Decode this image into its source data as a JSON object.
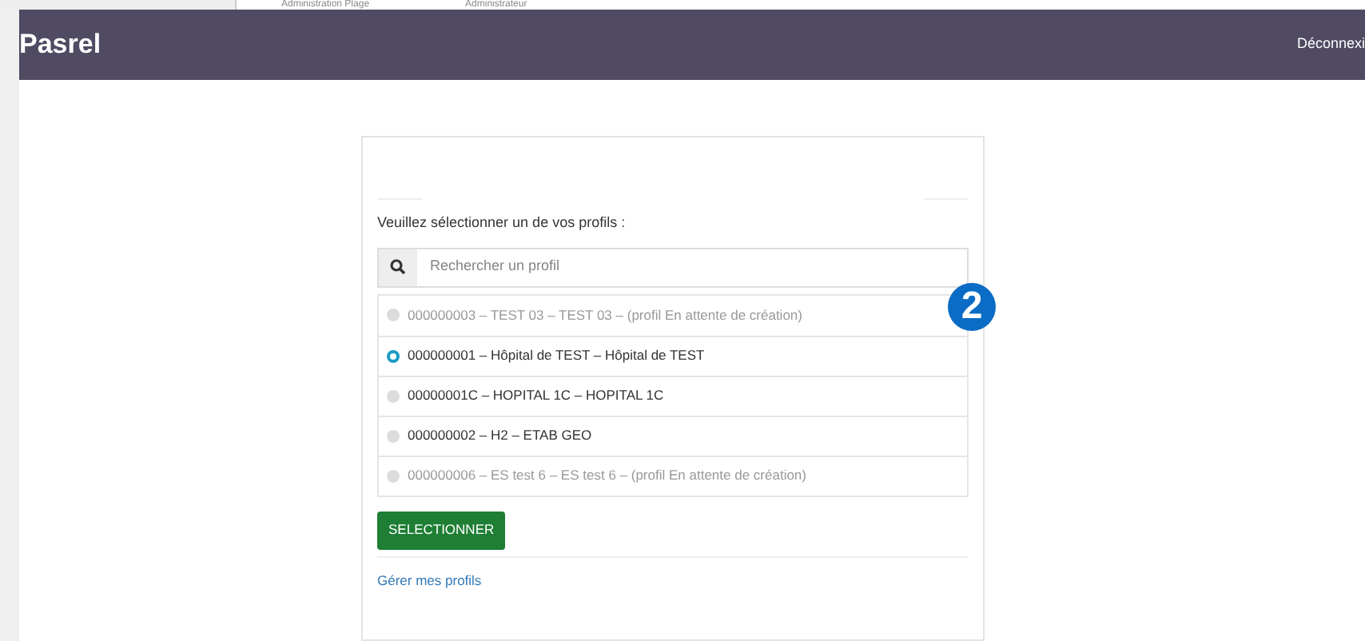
{
  "background_window": {
    "cells": [
      "Administration Plage",
      "Administrateur"
    ]
  },
  "navbar": {
    "brand": "Pasrel",
    "logout": "Déconnexi"
  },
  "form": {
    "prompt": "Veuillez sélectionner un de vos profils :",
    "search": {
      "placeholder": "Rechercher un profil"
    },
    "profiles": [
      {
        "label": "000000003 – TEST 03 – TEST 03 – (profil En attente de création)",
        "selected": false,
        "disabled": true
      },
      {
        "label": "000000001 – Hôpital de TEST – Hôpital de TEST",
        "selected": true,
        "disabled": false
      },
      {
        "label": "00000001C – HOPITAL 1C – HOPITAL 1C",
        "selected": false,
        "disabled": false
      },
      {
        "label": "000000002 – H2 – ETAB GEO",
        "selected": false,
        "disabled": false
      },
      {
        "label": "000000006 – ES test 6 – ES test 6 – (profil En attente de création)",
        "selected": false,
        "disabled": true
      }
    ],
    "submit": "SELECTIONNER",
    "manage_link": "Gérer mes profils"
  },
  "annotation": {
    "number": "2"
  }
}
